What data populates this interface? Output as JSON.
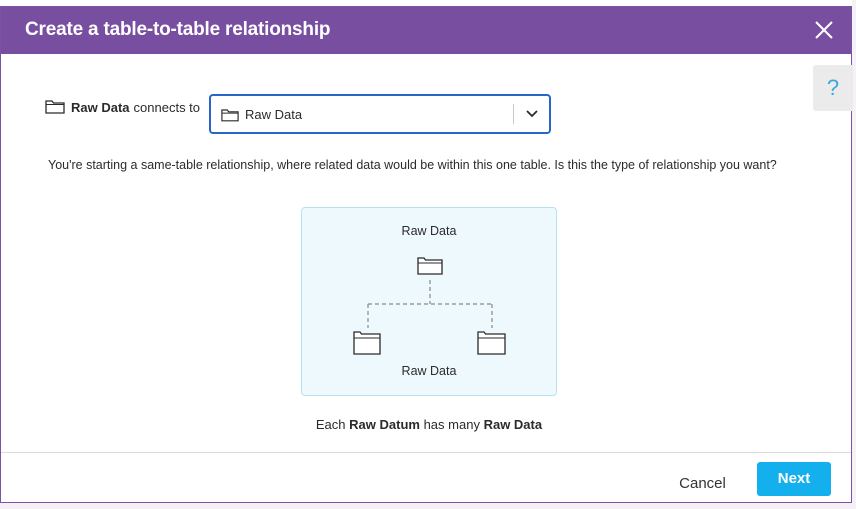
{
  "dialog": {
    "title": "Create a table-to-table relationship",
    "close_icon": "close-icon",
    "help_label": "?"
  },
  "connect": {
    "source_table": "Raw Data",
    "connects_text": "connects to",
    "target_selected": "Raw Data",
    "folder_icon": "folder-icon",
    "chevron_icon": "chevron-down-icon"
  },
  "question": "You're starting a same-table relationship, where related data would be within this one table. Is this the type of relationship you want?",
  "diagram": {
    "top_label": "Raw Data",
    "bottom_label": "Raw Data"
  },
  "summary": {
    "prefix": "Each",
    "singular": "Raw Datum",
    "middle": "has many",
    "plural": "Raw Data"
  },
  "footer": {
    "cancel_label": "Cancel",
    "next_label": "Next"
  },
  "colors": {
    "titlebar": "#784ea0",
    "primary_button": "#14b0ee",
    "select_border": "#2a66c9",
    "diagram_bg": "#eef9fd",
    "help_icon": "#3aa6e0"
  }
}
